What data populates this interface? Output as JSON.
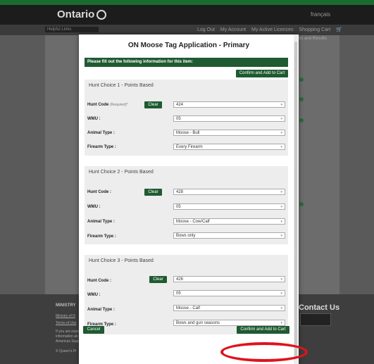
{
  "header": {
    "logo_text": "Ontario",
    "language_link": "français"
  },
  "nav": {
    "helpful_links": "Helpful Links",
    "log_out": "Log Out",
    "my_account": "My Account",
    "my_active_licences": "My Active Licences",
    "shopping_cart": "Shopping Cart"
  },
  "background": {
    "results_text": "es and Results",
    "ministry": "MINISTRY",
    "link1": "Ministry of N",
    "link2": "Terms of Use",
    "info1": "If you are expe",
    "info2": "information ab",
    "info3": "Americas Supp",
    "copyright": "© Queen's Pr",
    "contact_us": "Contact Us"
  },
  "modal": {
    "title": "ON Moose Tag Application - Primary",
    "instructions": "Please fill out the following information for this item:",
    "confirm_top": "Confirm and Add to Cart",
    "confirm_bottom": "Confirm and Add to Cart",
    "cancel": "Cancel"
  },
  "sections": [
    {
      "title": "Hunt Choice 1 - Points Based",
      "hunt_code_label": "Hunt Code",
      "required_note": "(Required)*",
      "clear": "Clear",
      "hunt_code": "424",
      "wmu_label": "WMU :",
      "wmu": "05",
      "animal_label": "Animal Type :",
      "animal": "Moose - Bull",
      "firearm_label": "Firearm Type :",
      "firearm": "Every Firearm"
    },
    {
      "title": "Hunt Choice 2 - Points Based",
      "hunt_code_label": "Hunt Code :",
      "clear": "Clear",
      "hunt_code": "428",
      "wmu_label": "WMU :",
      "wmu": "05",
      "animal_label": "Animal Type :",
      "animal": "Moose - Cow/Calf",
      "firearm_label": "Firearm Type :",
      "firearm": "Bows only"
    },
    {
      "title": "Hunt Choice 3 - Points Based",
      "hunt_code_label": "Hunt Code :",
      "clear": "Clear",
      "hunt_code": "426",
      "wmu_label": "WMU :",
      "wmu": "05",
      "animal_label": "Animal Type :",
      "animal": "Moose - Calf",
      "firearm_label": "Firearm Type :",
      "firearm": "Bows and gun seasons"
    }
  ],
  "colors": {
    "ontario_green": "#1f5a31",
    "highlight_red": "#e0121d"
  },
  "icons": {
    "cart": "shopping-cart-icon",
    "phone": "phone-icon",
    "dropdown": "chevron-down-icon"
  }
}
